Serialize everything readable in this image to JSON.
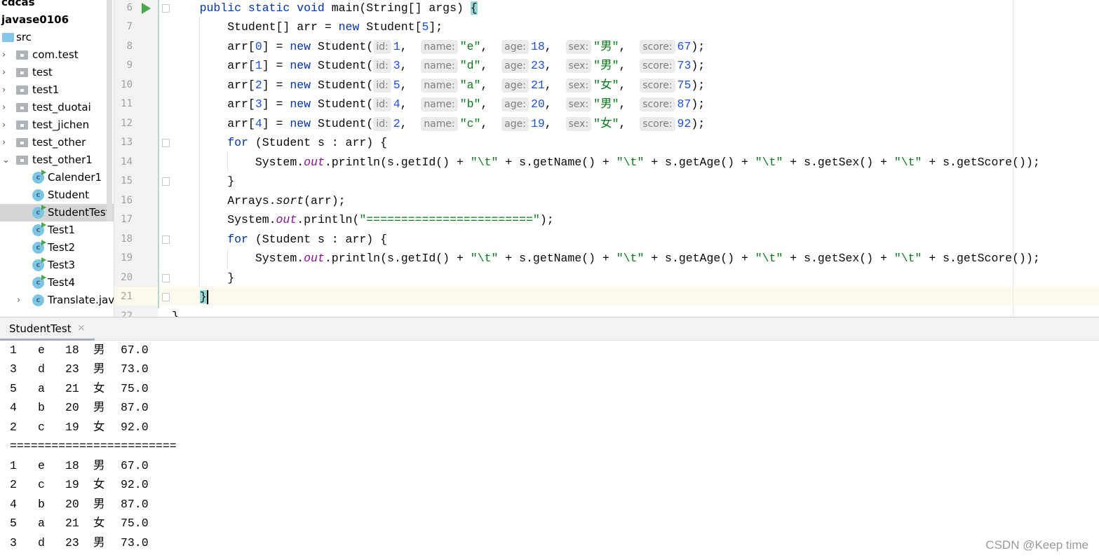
{
  "project_tree": [
    {
      "label": "cdcas",
      "kind": "bold",
      "indent": 0
    },
    {
      "label": "javase0106",
      "kind": "bold",
      "indent": 0
    },
    {
      "label": "src",
      "kind": "src",
      "indent": 0
    },
    {
      "label": "com.test",
      "kind": "folder",
      "chevron": "right"
    },
    {
      "label": "test",
      "kind": "folder",
      "chevron": "right"
    },
    {
      "label": "test1",
      "kind": "folder",
      "chevron": "right"
    },
    {
      "label": "test_duotai",
      "kind": "folder",
      "chevron": "right"
    },
    {
      "label": "test_jichen",
      "kind": "folder",
      "chevron": "right"
    },
    {
      "label": "test_other",
      "kind": "folder",
      "chevron": "right"
    },
    {
      "label": "test_other1",
      "kind": "folder",
      "chevron": "down"
    },
    {
      "label": "Calender1",
      "kind": "class",
      "runnable": true
    },
    {
      "label": "Student",
      "kind": "class",
      "runnable": false
    },
    {
      "label": "StudentTest",
      "kind": "class",
      "runnable": true,
      "selected": true
    },
    {
      "label": "Test1",
      "kind": "class",
      "runnable": true
    },
    {
      "label": "Test2",
      "kind": "class",
      "runnable": true
    },
    {
      "label": "Test3",
      "kind": "class",
      "runnable": true
    },
    {
      "label": "Test4",
      "kind": "class",
      "runnable": true
    },
    {
      "label": "Translate.java",
      "kind": "class",
      "runnable": false,
      "chevron": "right"
    }
  ],
  "editor": {
    "line_numbers": [
      "6",
      "7",
      "8",
      "9",
      "10",
      "11",
      "12",
      "13",
      "14",
      "15",
      "16",
      "17",
      "18",
      "19",
      "20",
      "21",
      "22"
    ],
    "current_line": "21",
    "lines": [
      [
        [
          "plain",
          "    "
        ],
        [
          "kw",
          "public static void"
        ],
        [
          "plain",
          " main(String[] args) "
        ],
        [
          "brace",
          "{"
        ]
      ],
      [
        [
          "plain",
          "        Student[] arr = "
        ],
        [
          "kw",
          "new"
        ],
        [
          "plain",
          " Student["
        ],
        [
          "num",
          "5"
        ],
        [
          "plain",
          "];"
        ]
      ],
      [
        [
          "plain",
          "        arr["
        ],
        [
          "num",
          "0"
        ],
        [
          "plain",
          "] = "
        ],
        [
          "kw",
          "new"
        ],
        [
          "plain",
          " Student("
        ],
        [
          "hint",
          "id:"
        ],
        [
          "num",
          "1"
        ],
        [
          "plain",
          ",  "
        ],
        [
          "hint",
          "name:"
        ],
        [
          "str",
          "\"e\""
        ],
        [
          "plain",
          ",  "
        ],
        [
          "hint",
          "age:"
        ],
        [
          "num",
          "18"
        ],
        [
          "plain",
          ",  "
        ],
        [
          "hint",
          "sex:"
        ],
        [
          "str",
          "\"男\""
        ],
        [
          "plain",
          ",  "
        ],
        [
          "hint",
          "score:"
        ],
        [
          "num",
          "67"
        ],
        [
          "plain",
          ");"
        ]
      ],
      [
        [
          "plain",
          "        arr["
        ],
        [
          "num",
          "1"
        ],
        [
          "plain",
          "] = "
        ],
        [
          "kw",
          "new"
        ],
        [
          "plain",
          " Student("
        ],
        [
          "hint",
          "id:"
        ],
        [
          "num",
          "3"
        ],
        [
          "plain",
          ",  "
        ],
        [
          "hint",
          "name:"
        ],
        [
          "str",
          "\"d\""
        ],
        [
          "plain",
          ",  "
        ],
        [
          "hint",
          "age:"
        ],
        [
          "num",
          "23"
        ],
        [
          "plain",
          ",  "
        ],
        [
          "hint",
          "sex:"
        ],
        [
          "str",
          "\"男\""
        ],
        [
          "plain",
          ",  "
        ],
        [
          "hint",
          "score:"
        ],
        [
          "num",
          "73"
        ],
        [
          "plain",
          ");"
        ]
      ],
      [
        [
          "plain",
          "        arr["
        ],
        [
          "num",
          "2"
        ],
        [
          "plain",
          "] = "
        ],
        [
          "kw",
          "new"
        ],
        [
          "plain",
          " Student("
        ],
        [
          "hint",
          "id:"
        ],
        [
          "num",
          "5"
        ],
        [
          "plain",
          ",  "
        ],
        [
          "hint",
          "name:"
        ],
        [
          "str",
          "\"a\""
        ],
        [
          "plain",
          ",  "
        ],
        [
          "hint",
          "age:"
        ],
        [
          "num",
          "21"
        ],
        [
          "plain",
          ",  "
        ],
        [
          "hint",
          "sex:"
        ],
        [
          "str",
          "\"女\""
        ],
        [
          "plain",
          ",  "
        ],
        [
          "hint",
          "score:"
        ],
        [
          "num",
          "75"
        ],
        [
          "plain",
          ");"
        ]
      ],
      [
        [
          "plain",
          "        arr["
        ],
        [
          "num",
          "3"
        ],
        [
          "plain",
          "] = "
        ],
        [
          "kw",
          "new"
        ],
        [
          "plain",
          " Student("
        ],
        [
          "hint",
          "id:"
        ],
        [
          "num",
          "4"
        ],
        [
          "plain",
          ",  "
        ],
        [
          "hint",
          "name:"
        ],
        [
          "str",
          "\"b\""
        ],
        [
          "plain",
          ",  "
        ],
        [
          "hint",
          "age:"
        ],
        [
          "num",
          "20"
        ],
        [
          "plain",
          ",  "
        ],
        [
          "hint",
          "sex:"
        ],
        [
          "str",
          "\"男\""
        ],
        [
          "plain",
          ",  "
        ],
        [
          "hint",
          "score:"
        ],
        [
          "num",
          "87"
        ],
        [
          "plain",
          ");"
        ]
      ],
      [
        [
          "plain",
          "        arr["
        ],
        [
          "num",
          "4"
        ],
        [
          "plain",
          "] = "
        ],
        [
          "kw",
          "new"
        ],
        [
          "plain",
          " Student("
        ],
        [
          "hint",
          "id:"
        ],
        [
          "num",
          "2"
        ],
        [
          "plain",
          ",  "
        ],
        [
          "hint",
          "name:"
        ],
        [
          "str",
          "\"c\""
        ],
        [
          "plain",
          ",  "
        ],
        [
          "hint",
          "age:"
        ],
        [
          "num",
          "19"
        ],
        [
          "plain",
          ",  "
        ],
        [
          "hint",
          "sex:"
        ],
        [
          "str",
          "\"女\""
        ],
        [
          "plain",
          ",  "
        ],
        [
          "hint",
          "score:"
        ],
        [
          "num",
          "92"
        ],
        [
          "plain",
          ");"
        ]
      ],
      [
        [
          "plain",
          "        "
        ],
        [
          "kw",
          "for"
        ],
        [
          "plain",
          " (Student s : arr) {"
        ]
      ],
      [
        [
          "plain",
          "            System."
        ],
        [
          "field",
          "out"
        ],
        [
          "plain",
          ".println(s.getId() + "
        ],
        [
          "str",
          "\"\\t\""
        ],
        [
          "plain",
          " + s.getName() + "
        ],
        [
          "str",
          "\"\\t\""
        ],
        [
          "plain",
          " + s.getAge() + "
        ],
        [
          "str",
          "\"\\t\""
        ],
        [
          "plain",
          " + s.getSex() + "
        ],
        [
          "str",
          "\"\\t\""
        ],
        [
          "plain",
          " + s.getScore());"
        ]
      ],
      [
        [
          "plain",
          "        }"
        ]
      ],
      [
        [
          "plain",
          "        Arrays."
        ],
        [
          "static",
          "sort"
        ],
        [
          "plain",
          "(arr);"
        ]
      ],
      [
        [
          "plain",
          "        System."
        ],
        [
          "field",
          "out"
        ],
        [
          "plain",
          ".println("
        ],
        [
          "str",
          "\"========================\""
        ],
        [
          "plain",
          ");"
        ]
      ],
      [
        [
          "plain",
          "        "
        ],
        [
          "kw",
          "for"
        ],
        [
          "plain",
          " (Student s : arr) {"
        ]
      ],
      [
        [
          "plain",
          "            System."
        ],
        [
          "field",
          "out"
        ],
        [
          "plain",
          ".println(s.getId() + "
        ],
        [
          "str",
          "\"\\t\""
        ],
        [
          "plain",
          " + s.getName() + "
        ],
        [
          "str",
          "\"\\t\""
        ],
        [
          "plain",
          " + s.getAge() + "
        ],
        [
          "str",
          "\"\\t\""
        ],
        [
          "plain",
          " + s.getSex() + "
        ],
        [
          "str",
          "\"\\t\""
        ],
        [
          "plain",
          " + s.getScore());"
        ]
      ],
      [
        [
          "plain",
          "        }"
        ]
      ],
      [
        [
          "plain",
          "    "
        ],
        [
          "brace",
          "}"
        ],
        [
          "caret",
          ""
        ]
      ],
      [
        [
          "plain",
          "}"
        ]
      ]
    ]
  },
  "run_panel": {
    "tab_label": "StudentTest",
    "close_glyph": "×",
    "output": [
      [
        "1",
        "e",
        "18",
        "男",
        "67.0"
      ],
      [
        "3",
        "d",
        "23",
        "男",
        "73.0"
      ],
      [
        "5",
        "a",
        "21",
        "女",
        "75.0"
      ],
      [
        "4",
        "b",
        "20",
        "男",
        "87.0"
      ],
      [
        "2",
        "c",
        "19",
        "女",
        "92.0"
      ],
      [
        "========================"
      ],
      [
        "1",
        "e",
        "18",
        "男",
        "67.0"
      ],
      [
        "2",
        "c",
        "19",
        "女",
        "92.0"
      ],
      [
        "4",
        "b",
        "20",
        "男",
        "87.0"
      ],
      [
        "5",
        "a",
        "21",
        "女",
        "75.0"
      ],
      [
        "3",
        "d",
        "23",
        "男",
        "73.0"
      ]
    ]
  },
  "watermark": "CSDN @Keep time",
  "colors": {
    "keyword": "#0033b3",
    "number": "#1750eb",
    "string": "#067d17",
    "field": "#871094",
    "run_green": "#4aaa4a"
  }
}
